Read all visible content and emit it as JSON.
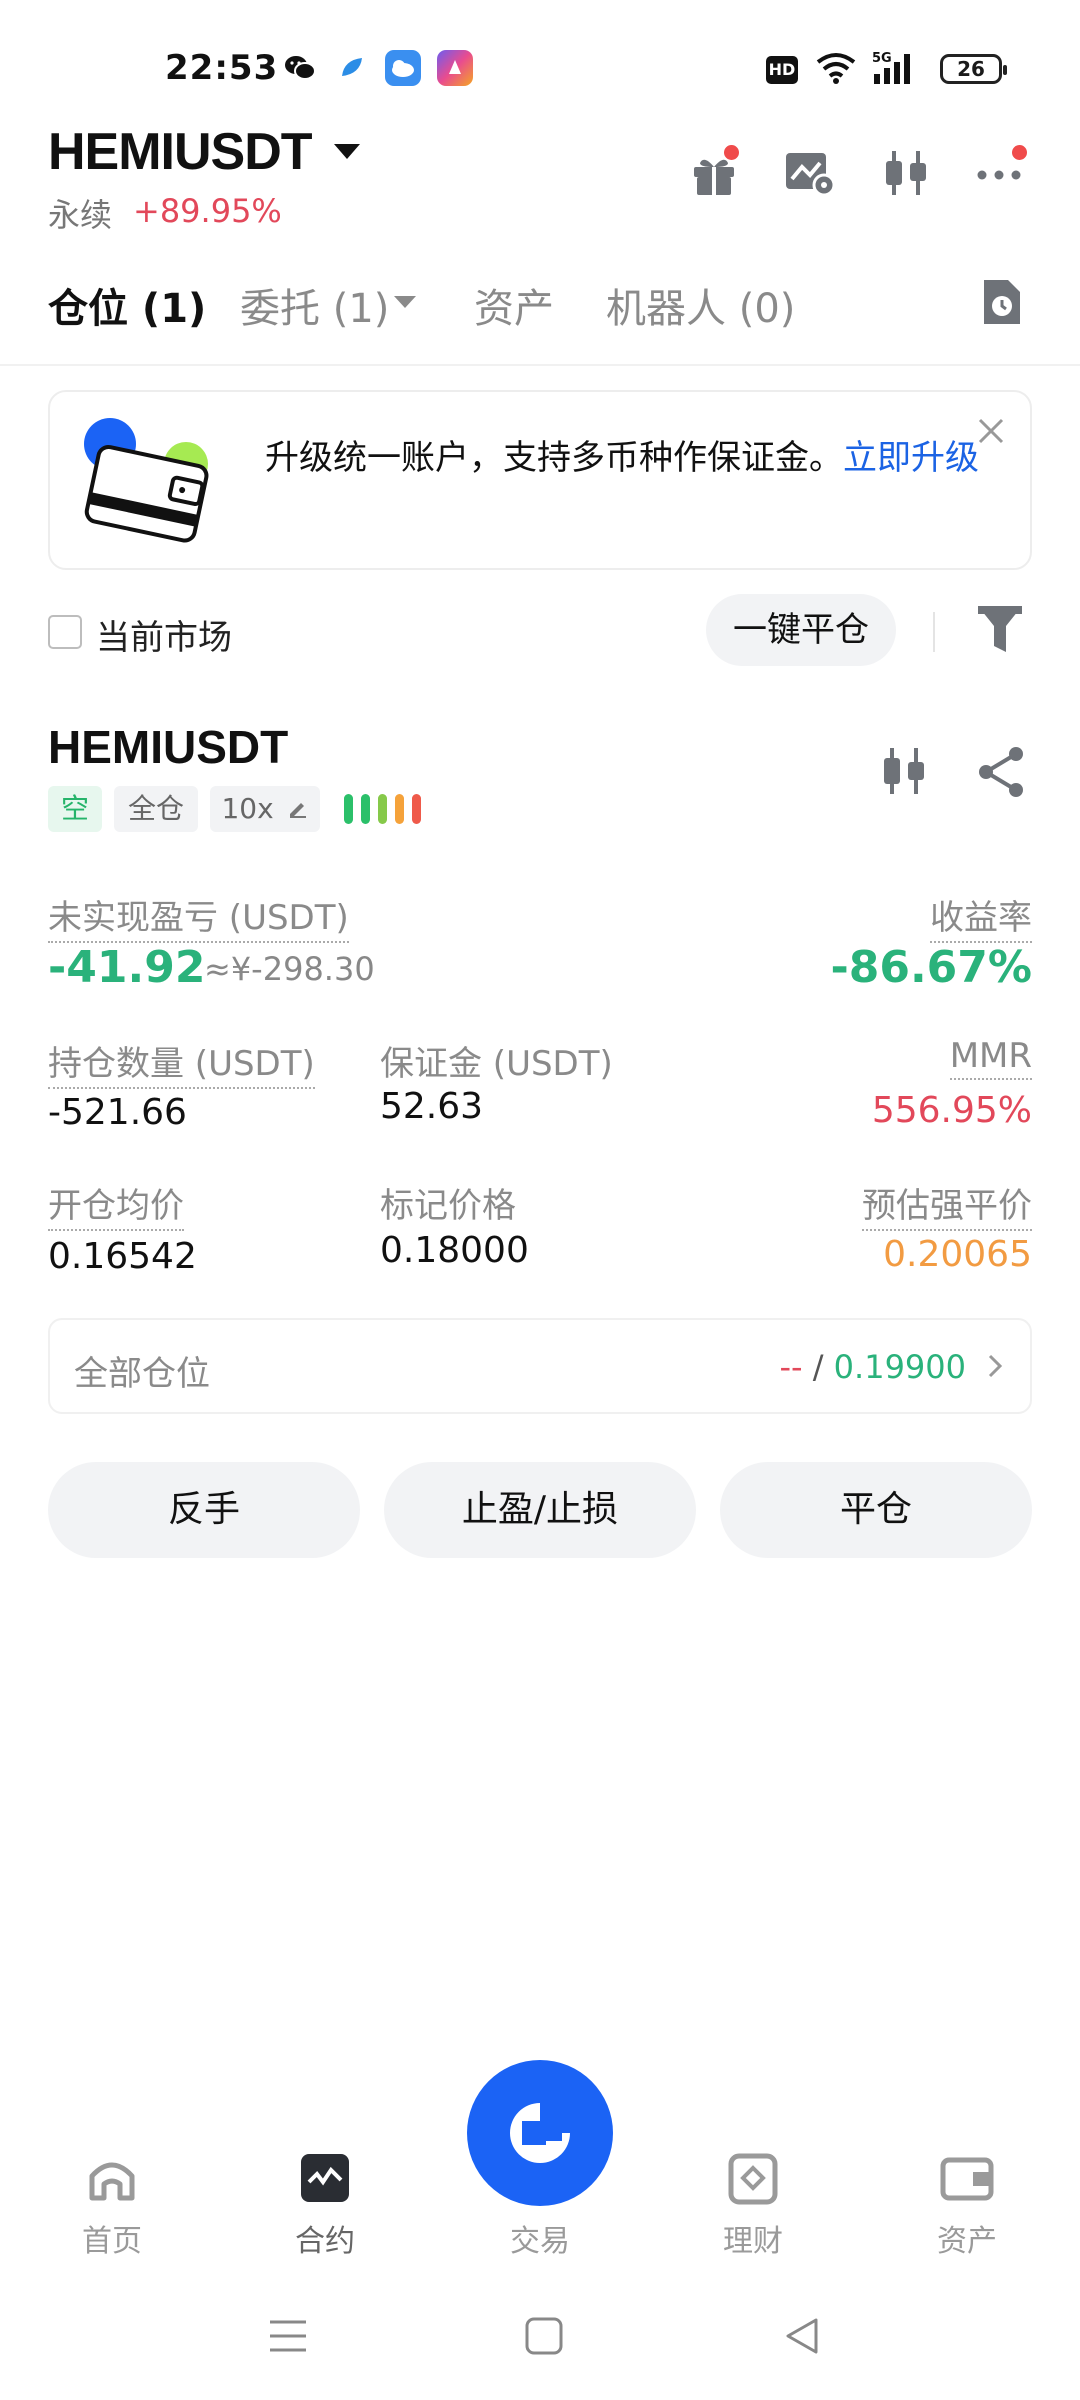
{
  "status_bar": {
    "time": "22:53",
    "battery": "26",
    "network": "5G",
    "hd": "HD"
  },
  "header": {
    "pair": "HEMIUSDT",
    "type": "永续",
    "change": "+89.95%"
  },
  "tabs": [
    {
      "label": "仓位 (1)"
    },
    {
      "label": "委托 (1)"
    },
    {
      "label": "资产"
    },
    {
      "label": "机器人 (0)"
    }
  ],
  "banner": {
    "text": "升级统一账户，支持多币种作保证金。",
    "link": "立即升级"
  },
  "filter": {
    "current_market": "当前市场",
    "close_all": "一键平仓"
  },
  "position": {
    "symbol": "HEMIUSDT",
    "side": "空",
    "margin_mode": "全仓",
    "leverage": "10x",
    "unrealized_pnl_label": "未实现盈亏 (USDT)",
    "unrealized_pnl": "-41.92",
    "unrealized_pnl_cny": "≈¥-298.30",
    "roe_label": "收益率",
    "roe": "-86.67%",
    "size_label": "持仓数量 (USDT)",
    "size": "-521.66",
    "margin_label": "保证金 (USDT)",
    "margin": "52.63",
    "mmr_label": "MMR",
    "mmr": "556.95%",
    "entry_label": "开仓均价",
    "entry": "0.16542",
    "mark_label": "标记价格",
    "mark": "0.18000",
    "liq_label": "预估强平价",
    "liq": "0.20065",
    "all_positions_label": "全部仓位",
    "all_positions_left": "--",
    "all_positions_sep": " / ",
    "all_positions_right": "0.19900"
  },
  "actions": {
    "reverse": "反手",
    "tpsl": "止盈/止损",
    "close": "平仓"
  },
  "bottom_nav": [
    {
      "label": "首页",
      "icon": "home-icon"
    },
    {
      "label": "合约",
      "icon": "futures-icon"
    },
    {
      "label": "交易",
      "icon": "trade-icon"
    },
    {
      "label": "理财",
      "icon": "earn-icon"
    },
    {
      "label": "资产",
      "icon": "wallet-icon"
    }
  ],
  "colors": {
    "green": "#2ab27b",
    "red": "#e2485a",
    "orange": "#f29b42",
    "brand_blue": "#1b63f5"
  }
}
